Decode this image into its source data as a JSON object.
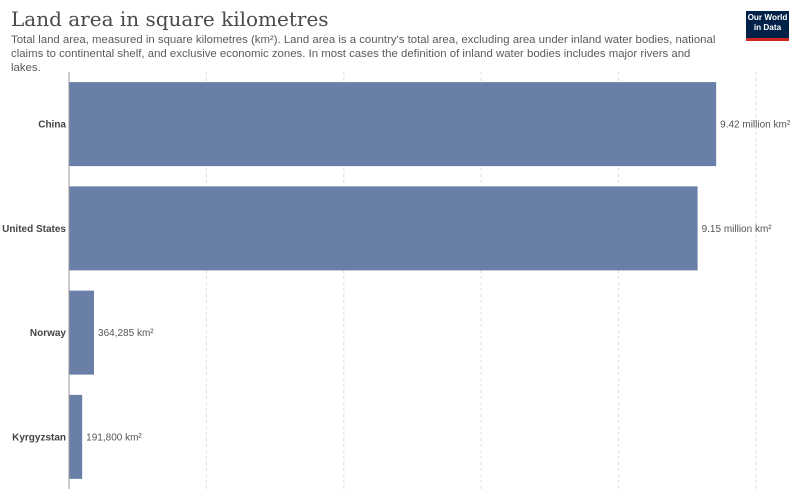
{
  "header": {
    "title": "Land area in square kilometres",
    "subtitle": "Total land area, measured in square kilometres (km²). Land area is a country's total area, excluding area under inland water bodies, national claims to continental shelf, and exclusive economic zones. In most cases the definition of inland water bodies includes major rivers and lakes."
  },
  "logo": {
    "line1": "Our World",
    "line2": "in Data",
    "bg_color": "#002147",
    "accent_color": "#ce261e"
  },
  "chart_data": {
    "type": "bar",
    "orientation": "horizontal",
    "title": "Land area in square kilometres",
    "categories": [
      "China",
      "United States",
      "Norway",
      "Kyrgyzstan"
    ],
    "values": [
      9420000,
      9150000,
      364285,
      191800
    ],
    "value_labels": [
      "9.42 million km²",
      "9.15 million km²",
      "364,285 km²",
      "191,800 km²"
    ],
    "unit": "km²",
    "xlim": [
      0,
      10000000
    ],
    "gridline_values": [
      2000000,
      4000000,
      6000000,
      8000000,
      10000000
    ],
    "grid": true,
    "grid_style": "dashed vertical",
    "bar_color": "#6a7fa8",
    "legend": "none"
  }
}
